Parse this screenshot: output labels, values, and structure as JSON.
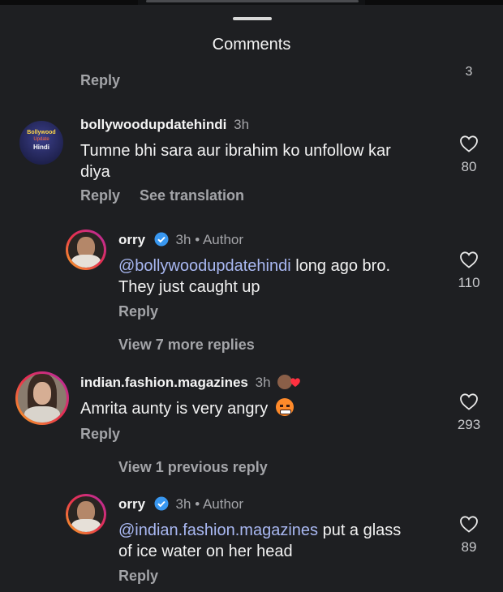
{
  "sheet": {
    "title": "Comments"
  },
  "top_partial": {
    "reply_label": "Reply",
    "like_count": "3"
  },
  "comments": [
    {
      "username": "bollywoodupdatehindi",
      "time": "3h",
      "line1": "Tumne bhi sara aur ibrahim ko unfollow kar",
      "line2": "diya",
      "reply_label": "Reply",
      "see_translation": "See translation",
      "like_count": "80",
      "avatar_text": [
        "Bollywood",
        "Update",
        "Hindi"
      ]
    },
    {
      "username": "orry",
      "time": "3h",
      "author_badge": "Author",
      "mention": "@bollywoodupdatehindi",
      "line1_rest": " long ago bro.",
      "line2": "They just caught up",
      "reply_label": "Reply",
      "like_count": "110",
      "view_more": "View 7 more replies"
    },
    {
      "username": "indian.fashion.magazines",
      "time": "3h",
      "line1": "Amrita aunty is very angry",
      "reply_label": "Reply",
      "like_count": "293",
      "view_previous": "View 1 previous reply"
    },
    {
      "username": "orry",
      "time": "3h",
      "author_badge": "Author",
      "mention": "@indian.fashion.magazines",
      "line1_rest": " put a glass",
      "line2": "of ice water on her head",
      "reply_label": "Reply",
      "like_count": "89"
    }
  ],
  "colors": {
    "background": "#1e1f22",
    "mention": "#a9b8f2",
    "verified": "#3897f0"
  }
}
